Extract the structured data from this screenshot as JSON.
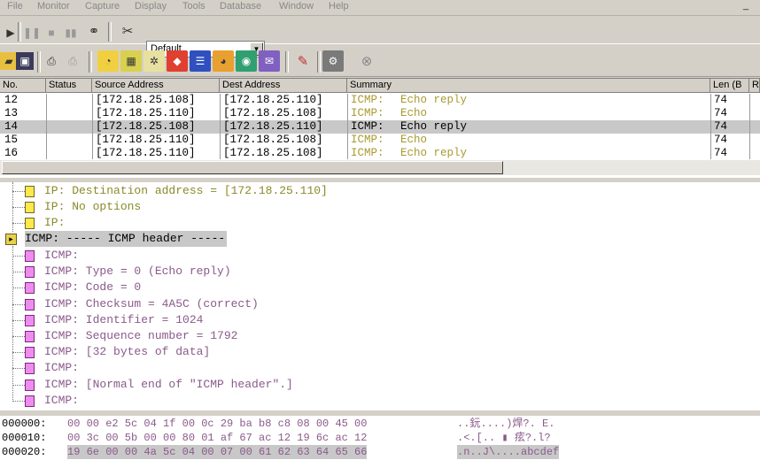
{
  "menu": [
    "File",
    "Monitor",
    "Capture",
    "Display",
    "Tools",
    "Database",
    "Window",
    "Help"
  ],
  "window_buttons": [
    "_",
    "□"
  ],
  "toolbar": {
    "filter_value": "Default",
    "icons1": [
      "play-icon",
      "pause-icon",
      "stop-icon",
      "stop-and-view-icon",
      "binoculars-icon",
      "filter-edit-icon"
    ],
    "icons2": [
      "open-icon",
      "save-icon",
      "print-icon",
      "print-setup-icon",
      "dashboard-icon",
      "matrix-icon",
      "host-table-icon",
      "protocol-dist-icon",
      "history-icon",
      "global-stats-icon",
      "alarm-log-icon",
      "address-book-icon",
      "expert-icon",
      "options-icon",
      "capture-buffer-icon"
    ]
  },
  "packet_list": {
    "columns": [
      "No.",
      "Status",
      "Source Address",
      "Dest Address",
      "Summary",
      "Len (B",
      "R"
    ],
    "rows": [
      {
        "no": "12",
        "src": "[172.18.25.108]",
        "dst": "[172.18.25.110]",
        "proto": "ICMP:",
        "summary": "Echo reply",
        "len": "74"
      },
      {
        "no": "13",
        "src": "[172.18.25.110]",
        "dst": "[172.18.25.108]",
        "proto": "ICMP:",
        "summary": "Echo",
        "len": "74"
      },
      {
        "no": "14",
        "src": "[172.18.25.108]",
        "dst": "[172.18.25.110]",
        "proto": "ICMP:",
        "summary": "Echo reply",
        "len": "74"
      },
      {
        "no": "15",
        "src": "[172.18.25.110]",
        "dst": "[172.18.25.108]",
        "proto": "ICMP:",
        "summary": "Echo",
        "len": "74"
      },
      {
        "no": "16",
        "src": "[172.18.25.110]",
        "dst": "[172.18.25.108]",
        "proto": "ICMP:",
        "summary": "Echo reply",
        "len": "74"
      }
    ],
    "selected_index": 2
  },
  "detail": {
    "ip_lines": [
      "IP: Destination address = [172.18.25.110]",
      "IP: No options",
      "IP:"
    ],
    "icmp_header": "ICMP: ----- ICMP header -----",
    "icmp_lines": [
      "ICMP:",
      "ICMP: Type = 0 (Echo reply)",
      "ICMP: Code = 0",
      "ICMP: Checksum = 4A5C (correct)",
      "ICMP: Identifier = 1024",
      "ICMP: Sequence number = 1792",
      "ICMP: [32 bytes of data]",
      "ICMP:",
      "ICMP: [Normal end of \"ICMP header\".]",
      "ICMP:"
    ]
  },
  "hex": [
    {
      "offset": "000000:",
      "bytes": "00 00 e2 5c 04 1f 00 0c 29 ba b8 c8 08 00 45 00",
      "ascii": "..鈨....)焊?. E."
    },
    {
      "offset": "000010:",
      "bytes": "00 3c 00 5b 00 00 80 01 af 67 ac 12 19 6c ac 12",
      "ascii": ".<.[.. ▮ 痃?.l?"
    },
    {
      "offset": "000020:",
      "bytes": "19 6e 00 00 4a 5c 04 00 07 00 61 62 63 64 65 66",
      "ascii": ".n..J\\....abcdef"
    }
  ],
  "colors": {
    "ip": "#8a8a2a",
    "icmp": "#8a5a8a",
    "echo": "#a89a30"
  }
}
